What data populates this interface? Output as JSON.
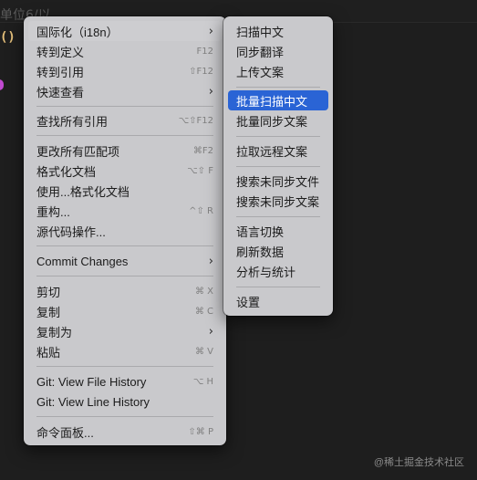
{
  "editor": {
    "ghost_text": "单位6/以",
    "paren": "()"
  },
  "main_menu": {
    "items": [
      {
        "label": "国际化（i18n）",
        "shortcut": "",
        "chevron": "›"
      },
      {
        "label": "转到定义",
        "shortcut": "F12",
        "chevron": ""
      },
      {
        "label": "转到引用",
        "shortcut": "⇧F12",
        "chevron": ""
      },
      {
        "label": "快速查看",
        "shortcut": "",
        "chevron": "›"
      },
      {
        "label": "查找所有引用",
        "shortcut": "⌥⇧F12",
        "chevron": ""
      },
      {
        "label": "更改所有匹配项",
        "shortcut": "⌘F2",
        "chevron": ""
      },
      {
        "label": "格式化文档",
        "shortcut": "⌥⇧ F",
        "chevron": ""
      },
      {
        "label": "使用...格式化文档",
        "shortcut": "",
        "chevron": ""
      },
      {
        "label": "重构...",
        "shortcut": "^⇧ R",
        "chevron": ""
      },
      {
        "label": "源代码操作...",
        "shortcut": "",
        "chevron": ""
      },
      {
        "label": "Commit Changes",
        "shortcut": "",
        "chevron": "›"
      },
      {
        "label": "剪切",
        "shortcut": "⌘ X",
        "chevron": ""
      },
      {
        "label": "复制",
        "shortcut": "⌘ C",
        "chevron": ""
      },
      {
        "label": "复制为",
        "shortcut": "",
        "chevron": "›"
      },
      {
        "label": "粘贴",
        "shortcut": "⌘ V",
        "chevron": ""
      },
      {
        "label": "Git: View File History",
        "shortcut": "⌥ H",
        "chevron": ""
      },
      {
        "label": "Git: View Line History",
        "shortcut": "",
        "chevron": ""
      },
      {
        "label": "命令面板...",
        "shortcut": "⇧⌘ P",
        "chevron": ""
      }
    ]
  },
  "sub_menu": {
    "items": [
      {
        "label": "扫描中文"
      },
      {
        "label": "同步翻译"
      },
      {
        "label": "上传文案"
      },
      {
        "label": "批量扫描中文"
      },
      {
        "label": "批量同步文案"
      },
      {
        "label": "拉取远程文案"
      },
      {
        "label": "搜索未同步文件"
      },
      {
        "label": "搜索未同步文案"
      },
      {
        "label": "语言切换"
      },
      {
        "label": "刷新数据"
      },
      {
        "label": "分析与统计"
      },
      {
        "label": "设置"
      }
    ]
  },
  "watermark": "@稀土掘金技术社区",
  "colors": {
    "menu_bg": "#c9c9cc",
    "highlight": "#2a64d5",
    "editor_bg": "#1e1e1e"
  }
}
